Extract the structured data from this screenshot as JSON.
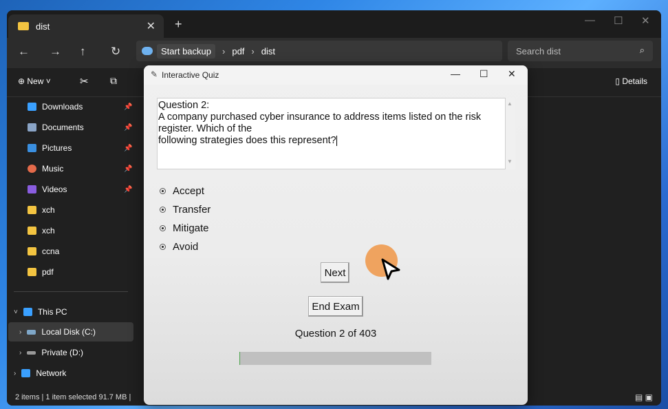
{
  "explorer": {
    "tab_title": "dist",
    "breadcrumb": [
      "Start backup",
      "pdf",
      "dist"
    ],
    "search_placeholder": "Search dist",
    "new_label": "New",
    "details_label": "Details",
    "sidebar": {
      "quick_access": [
        {
          "label": "Downloads",
          "icon": "download-icon",
          "color": "#3aa0ff",
          "pinned": true
        },
        {
          "label": "Documents",
          "icon": "document-icon",
          "color": "#8aa4c6",
          "pinned": true
        },
        {
          "label": "Pictures",
          "icon": "picture-icon",
          "color": "#3a8fe0",
          "pinned": true
        },
        {
          "label": "Music",
          "icon": "music-icon",
          "color": "#e46a4a",
          "pinned": true
        },
        {
          "label": "Videos",
          "icon": "video-icon",
          "color": "#8a5de0",
          "pinned": true
        },
        {
          "label": "xch",
          "icon": "folder-icon",
          "color": "#f3c441",
          "pinned": false
        },
        {
          "label": "xch",
          "icon": "folder-icon",
          "color": "#f3c441",
          "pinned": false
        },
        {
          "label": "ccna",
          "icon": "folder-icon",
          "color": "#f3c441",
          "pinned": false
        },
        {
          "label": "pdf",
          "icon": "folder-icon",
          "color": "#f3c441",
          "pinned": false
        }
      ],
      "this_pc": "This PC",
      "drives": [
        {
          "label": "Local Disk (C:)",
          "icon": "drive-icon"
        },
        {
          "label": "Private (D:)",
          "icon": "drive-icon"
        }
      ],
      "network": "Network"
    },
    "status": "2 items  |  1 item selected  91.7 MB  |"
  },
  "quiz": {
    "window_title": "Interactive Quiz",
    "question_text": "Question 2:\nA company purchased cyber insurance to address items listed on the risk register. Which of the\nfollowing strategies does this represent?",
    "options": [
      "Accept",
      "Transfer",
      "Mitigate",
      "Avoid"
    ],
    "next_label": "Next",
    "end_label": "End Exam",
    "progress_label": "Question 2 of 403",
    "progress_fraction": 0.005
  }
}
